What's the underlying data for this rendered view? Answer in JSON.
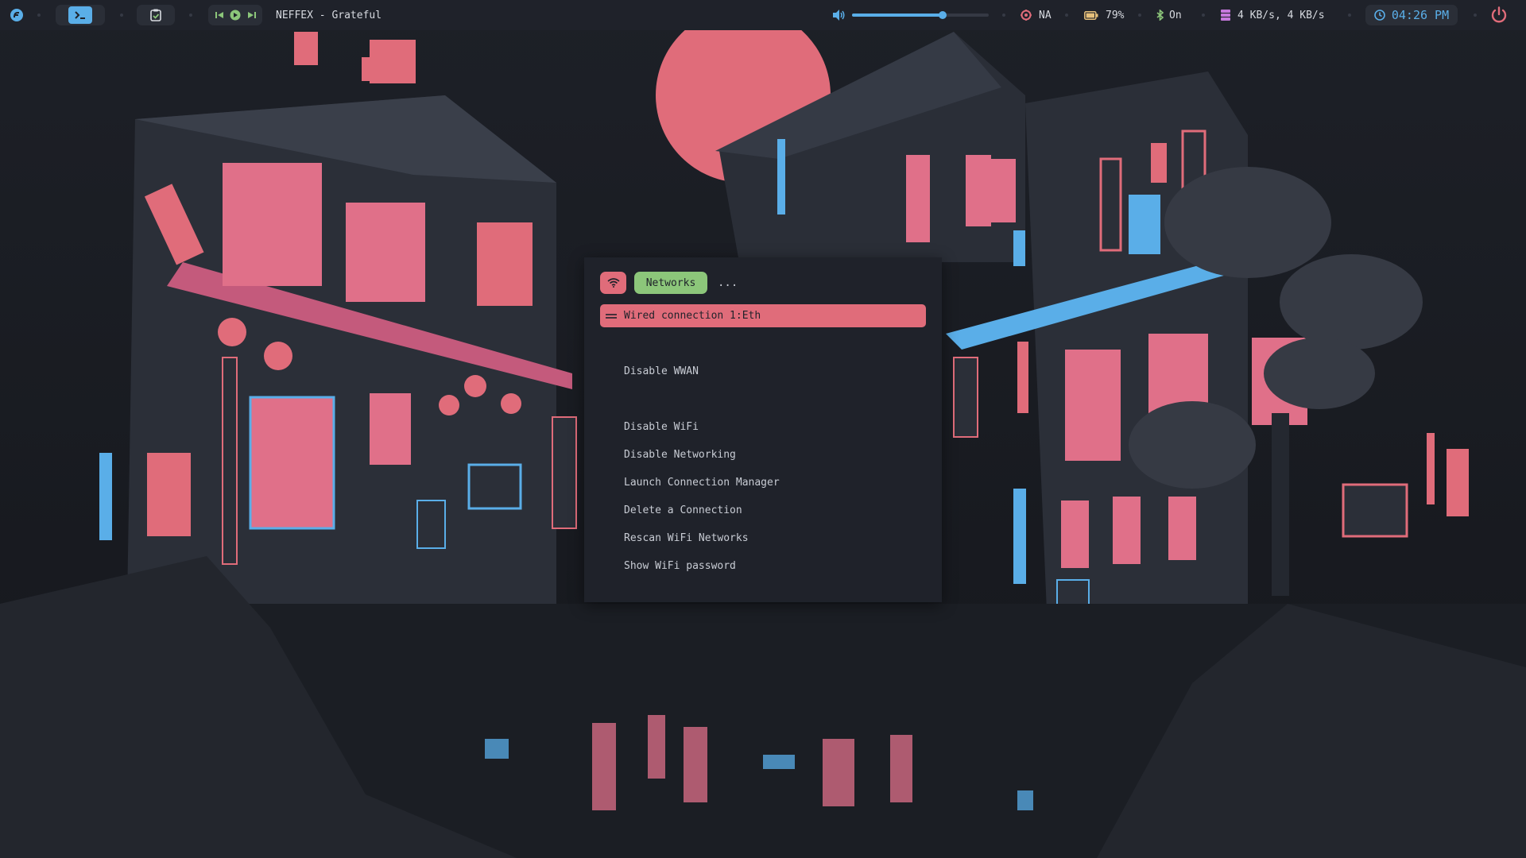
{
  "bar": {
    "now_playing": "NEFFEX - Grateful",
    "volume_level": 0.66,
    "cpu_temp": "NA",
    "battery": "79%",
    "bluetooth": "On",
    "network_speed": "4 KB/s, 4 KB/s",
    "clock": "04:26 PM"
  },
  "icons": {
    "launcher": "app-launcher-icon",
    "terminal": "terminal-icon",
    "clipboard": "clipboard-icon",
    "prev": "previous-track-icon",
    "play": "play-icon",
    "next": "next-track-icon",
    "volume": "volume-icon",
    "temperature": "temperature-icon",
    "battery": "battery-icon",
    "bluetooth": "bluetooth-icon",
    "network": "network-speed-icon",
    "clock": "clock-icon",
    "power": "power-icon",
    "wifi": "wifi-icon"
  },
  "menu": {
    "prompt": "Networks",
    "filter": "...",
    "selected": "Wired connection 1:Eth",
    "items": [
      "Disable WWAN",
      "Disable WiFi",
      "Disable Networking",
      "Launch Connection Manager",
      "Delete a Connection",
      "Rescan WiFi Networks",
      "Show WiFi password"
    ]
  },
  "colors": {
    "accent_pink": "#e06c7a",
    "accent_green": "#8cc67a",
    "accent_blue": "#5aaee8",
    "bar_bg": "#1f222a",
    "pill_bg": "#2a2e37"
  }
}
